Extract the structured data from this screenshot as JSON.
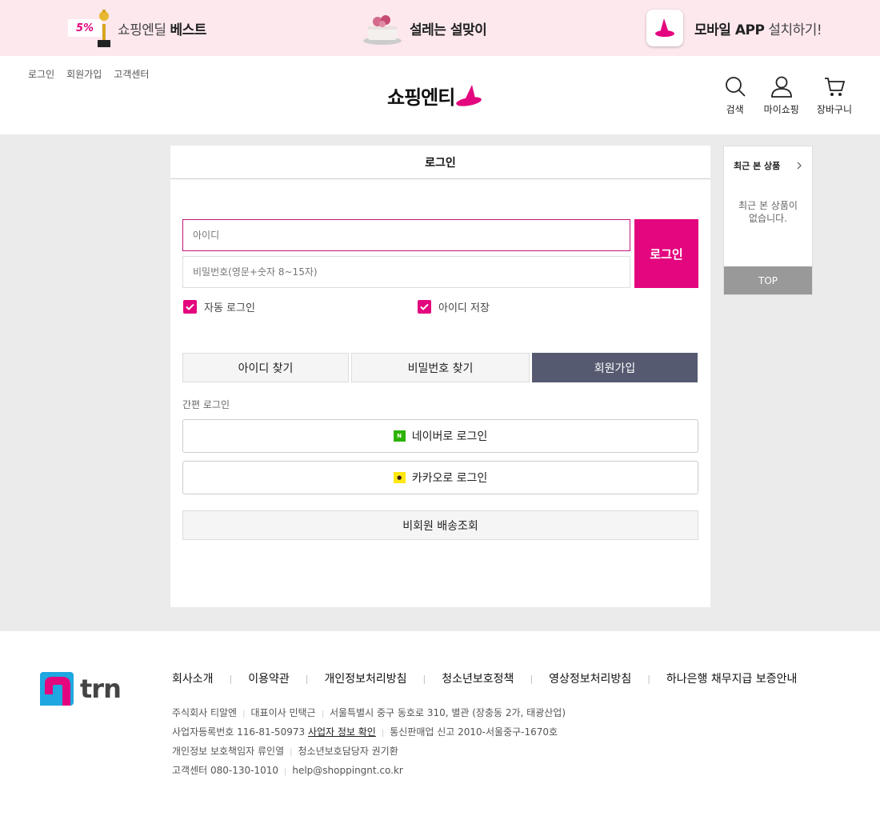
{
  "promo": {
    "item1_badge": "5%",
    "item1_light": "쇼핑엔딜",
    "item1_bold": "베스트",
    "item2_bold": "설레는 설맞이",
    "item3_bold": "모바일 APP",
    "item3_light": "설치하기!"
  },
  "header": {
    "util_links": [
      "로그인",
      "회원가입",
      "고객센터"
    ],
    "logo_text": "쇼핑엔티",
    "icons": {
      "search": "검색",
      "mypage": "마이쇼핑",
      "cart": "장바구니"
    }
  },
  "login": {
    "title": "로그인",
    "id_placeholder": "아이디",
    "pw_placeholder": "비밀번호(영문+숫자 8~15자)",
    "login_button": "로그인",
    "auto_login": "자동 로그인",
    "save_id": "아이디 저장",
    "find_id": "아이디 찾기",
    "find_pw": "비밀번호 찾기",
    "signup": "회원가입",
    "easy_login_label": "간편 로그인",
    "naver_login": "네이버로 로그인",
    "kakao_login": "카카오로 로그인",
    "guest_delivery": "비회원 배송조회"
  },
  "side": {
    "title": "최근 본 상품",
    "empty_text": "최근 본 상품이 없습니다.",
    "top_button": "TOP"
  },
  "footer": {
    "logo_text": "trn",
    "links": [
      "회사소개",
      "이용약관",
      "개인정보처리방침",
      "청소년보호정책",
      "영상정보처리방침",
      "하나은행 채무지급 보증안내"
    ],
    "line1": [
      "주식회사 티알엔",
      "대표이사 민택근",
      "서울특별시 중구 동호로 310, 별관 (장충동 2가, 태광산업)"
    ],
    "line2_prefix": "사업자등록번호 116-81-50973",
    "line2_link": "사업자 정보 확인",
    "line2_suffix": "통신판매업 신고 2010-서울중구-1670호",
    "line3": [
      "개인정보 보호책임자 류인열",
      "청소년보호담당자 권기환"
    ],
    "line4": [
      "고객센터 080-130-1010",
      "help@shoppingnt.co.kr"
    ]
  },
  "colors": {
    "brand": "#e3067e",
    "promo_bg": "#fde8ee",
    "signup_bg": "#555a70",
    "naver": "#2db400",
    "kakao": "#ffe812"
  }
}
